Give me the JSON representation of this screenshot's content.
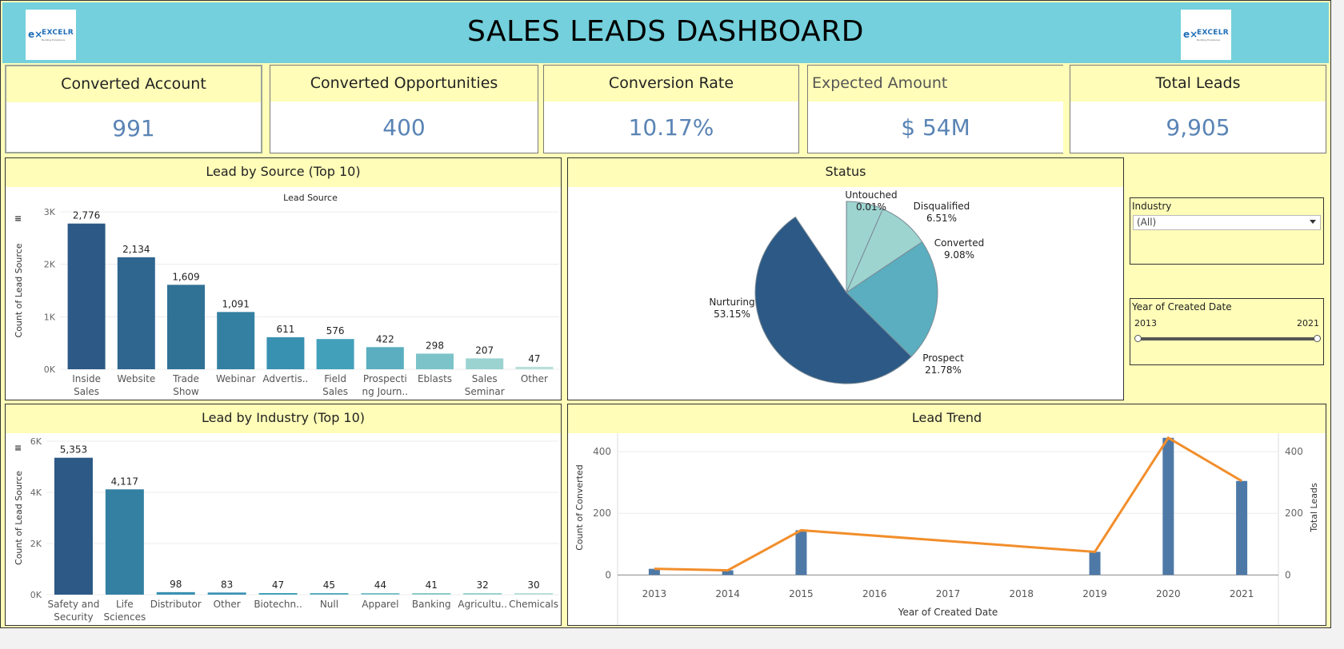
{
  "header": {
    "title": "SALES LEADS DASHBOARD",
    "logo_text": "EXCELR",
    "logo_tagline": "Building Excellence"
  },
  "kpis": [
    {
      "label": "Converted Account",
      "value": "991"
    },
    {
      "label": "Converted Opportunities",
      "value": "400"
    },
    {
      "label": "Conversion Rate",
      "value": "10.17%"
    },
    {
      "label": "Expected Amount",
      "value": "$ 54M"
    },
    {
      "label": "Total Leads",
      "value": "9,905"
    }
  ],
  "filters": {
    "industry": {
      "label": "Industry",
      "value": "(All)"
    },
    "year": {
      "label": "Year of Created Date",
      "min": "2013",
      "max": "2021"
    }
  },
  "chart_data": [
    {
      "type": "bar",
      "title": "Lead by Source (Top 10)",
      "subtitle": "Lead Source",
      "ylabel": "Count of Lead Source",
      "ylim": [
        0,
        3000
      ],
      "yticks": [
        {
          "v": 0,
          "t": "0K"
        },
        {
          "v": 1000,
          "t": "1K"
        },
        {
          "v": 2000,
          "t": "2K"
        },
        {
          "v": 3000,
          "t": "3K"
        }
      ],
      "categories": [
        [
          "Inside",
          "Sales"
        ],
        [
          "Website"
        ],
        [
          "Trade",
          "Show"
        ],
        [
          "Webinar"
        ],
        [
          "Advertis.."
        ],
        [
          "Field",
          "Sales"
        ],
        [
          "Prospecti",
          "ng Journ.."
        ],
        [
          "Eblasts"
        ],
        [
          "Sales",
          "Seminar"
        ],
        [
          "Other"
        ]
      ],
      "values": [
        2776,
        2134,
        1609,
        1091,
        611,
        576,
        422,
        298,
        207,
        47
      ],
      "labels": [
        "2,776",
        "2,134",
        "1,609",
        "1,091",
        "611",
        "576",
        "422",
        "298",
        "207",
        "47"
      ],
      "colors": [
        "#2c5985",
        "#2e6690",
        "#307296",
        "#3480a2",
        "#3991b2",
        "#43a0bb",
        "#5aaebf",
        "#7cc3c9",
        "#9bd3d1",
        "#b8e0da"
      ]
    },
    {
      "type": "pie",
      "title": "Status",
      "slices": [
        {
          "name": "Untouched",
          "pct": 0.01,
          "label": "0.01%",
          "color": "#9dd4d0"
        },
        {
          "name": "Disqualified",
          "pct": 6.51,
          "label": "6.51%",
          "color": "#9dd4d0"
        },
        {
          "name": "Converted",
          "pct": 9.08,
          "label": "9.08%",
          "color": "#9dd4d0"
        },
        {
          "name": "Prospect",
          "pct": 21.78,
          "label": "21.78%",
          "color": "#5aaebf"
        },
        {
          "name": "Nurturing",
          "pct": 53.15,
          "label": "53.15%",
          "color": "#2c5985"
        }
      ]
    },
    {
      "type": "bar",
      "title": "Lead by Industry (Top 10)",
      "ylabel": "Count of Lead Source",
      "ylim": [
        0,
        6000
      ],
      "yticks": [
        {
          "v": 0,
          "t": "0K"
        },
        {
          "v": 2000,
          "t": "2K"
        },
        {
          "v": 4000,
          "t": "4K"
        },
        {
          "v": 6000,
          "t": "6K"
        }
      ],
      "categories": [
        [
          "Safety and",
          "Security"
        ],
        [
          "Life",
          "Sciences"
        ],
        [
          "Distributor"
        ],
        [
          "Other"
        ],
        [
          "Biotechn.."
        ],
        [
          "Null"
        ],
        [
          "Apparel"
        ],
        [
          "Banking"
        ],
        [
          "Agricultu.."
        ],
        [
          "Chemicals"
        ]
      ],
      "values": [
        5353,
        4117,
        98,
        83,
        47,
        45,
        44,
        41,
        32,
        30
      ],
      "labels": [
        "5,353",
        "4,117",
        "98",
        "83",
        "47",
        "45",
        "44",
        "41",
        "32",
        "30"
      ],
      "colors": [
        "#2c5985",
        "#3480a2",
        "#3991b2",
        "#3991b2",
        "#43a0bb",
        "#5aaebf",
        "#7cc3c9",
        "#8ccbcb",
        "#9bd3d1",
        "#b8e0da"
      ]
    },
    {
      "type": "bar+line",
      "title": "Lead Trend",
      "xlabel": "Year of Created Date",
      "ylabel_left": "Count of Converted",
      "ylabel_right": "Total Leads",
      "ylim": [
        -25,
        460
      ],
      "yticks": [
        0,
        200,
        400
      ],
      "x": [
        "2013",
        "2014",
        "2015",
        "2016",
        "2017",
        "2018",
        "2019",
        "2020",
        "2021"
      ],
      "series": [
        {
          "values": [
            20,
            15,
            145,
            null,
            null,
            null,
            75,
            445,
            305
          ],
          "color": "#4e79a7"
        },
        {
          "values": [
            20,
            15,
            145,
            null,
            null,
            null,
            75,
            445,
            305
          ],
          "color": "#f28e2b"
        }
      ]
    }
  ]
}
